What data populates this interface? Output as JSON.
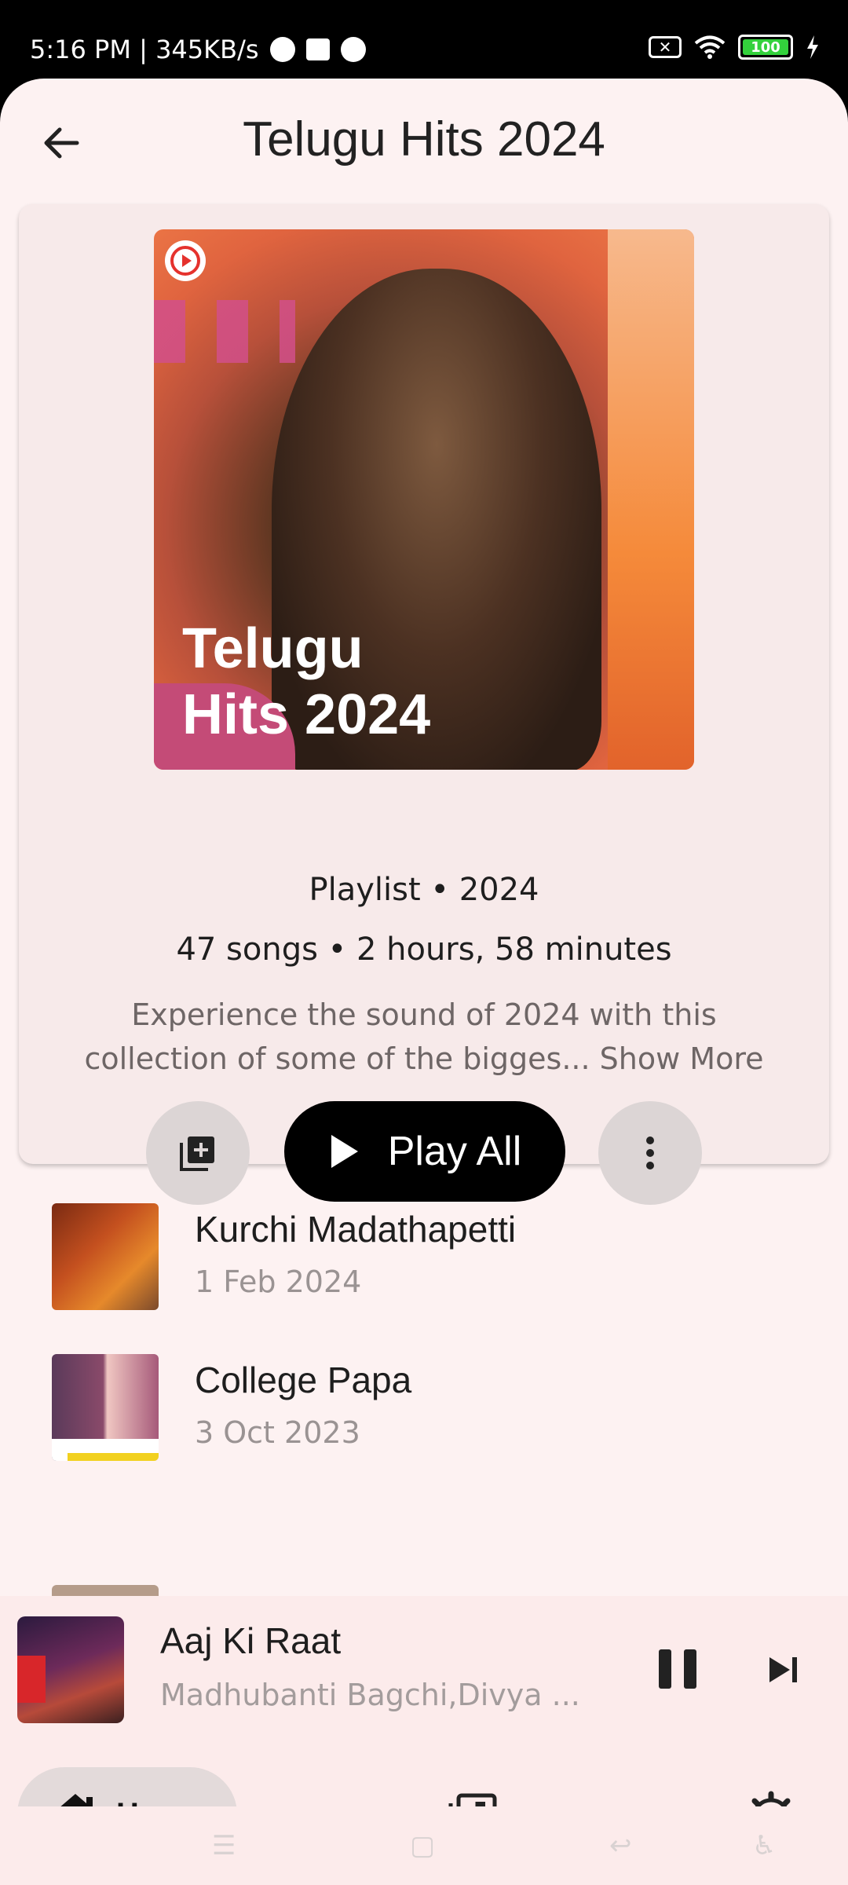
{
  "status_bar": {
    "time_speed": "5:16 PM | 345KB/s",
    "battery": "100"
  },
  "header": {
    "title": "Telugu Hits 2024",
    "back_icon": "arrow-back-icon"
  },
  "playlist": {
    "cover_line1": "Telugu",
    "cover_line2": "Hits 2024",
    "type_line": "Playlist • 2024",
    "count_line": "47 songs • 2 hours, 58 minutes",
    "description_line1": "Experience the sound of 2024 with this",
    "description_line2": "collection of some of the bigges... Show More",
    "play_all_label": "Play All"
  },
  "songs": [
    {
      "title": "Kurchi Madathapetti",
      "date": "1 Feb 2024"
    },
    {
      "title": "College Papa",
      "date": "3 Oct 2023"
    }
  ],
  "now_playing": {
    "title": "Aaj Ki Raat",
    "artist": "Madhubanti Bagchi,Divya ..."
  },
  "bottom_nav": {
    "home_label": "Home"
  },
  "colors": {
    "background": "#fdf2f2",
    "card": "#f7eaea",
    "accent": "#000000"
  }
}
